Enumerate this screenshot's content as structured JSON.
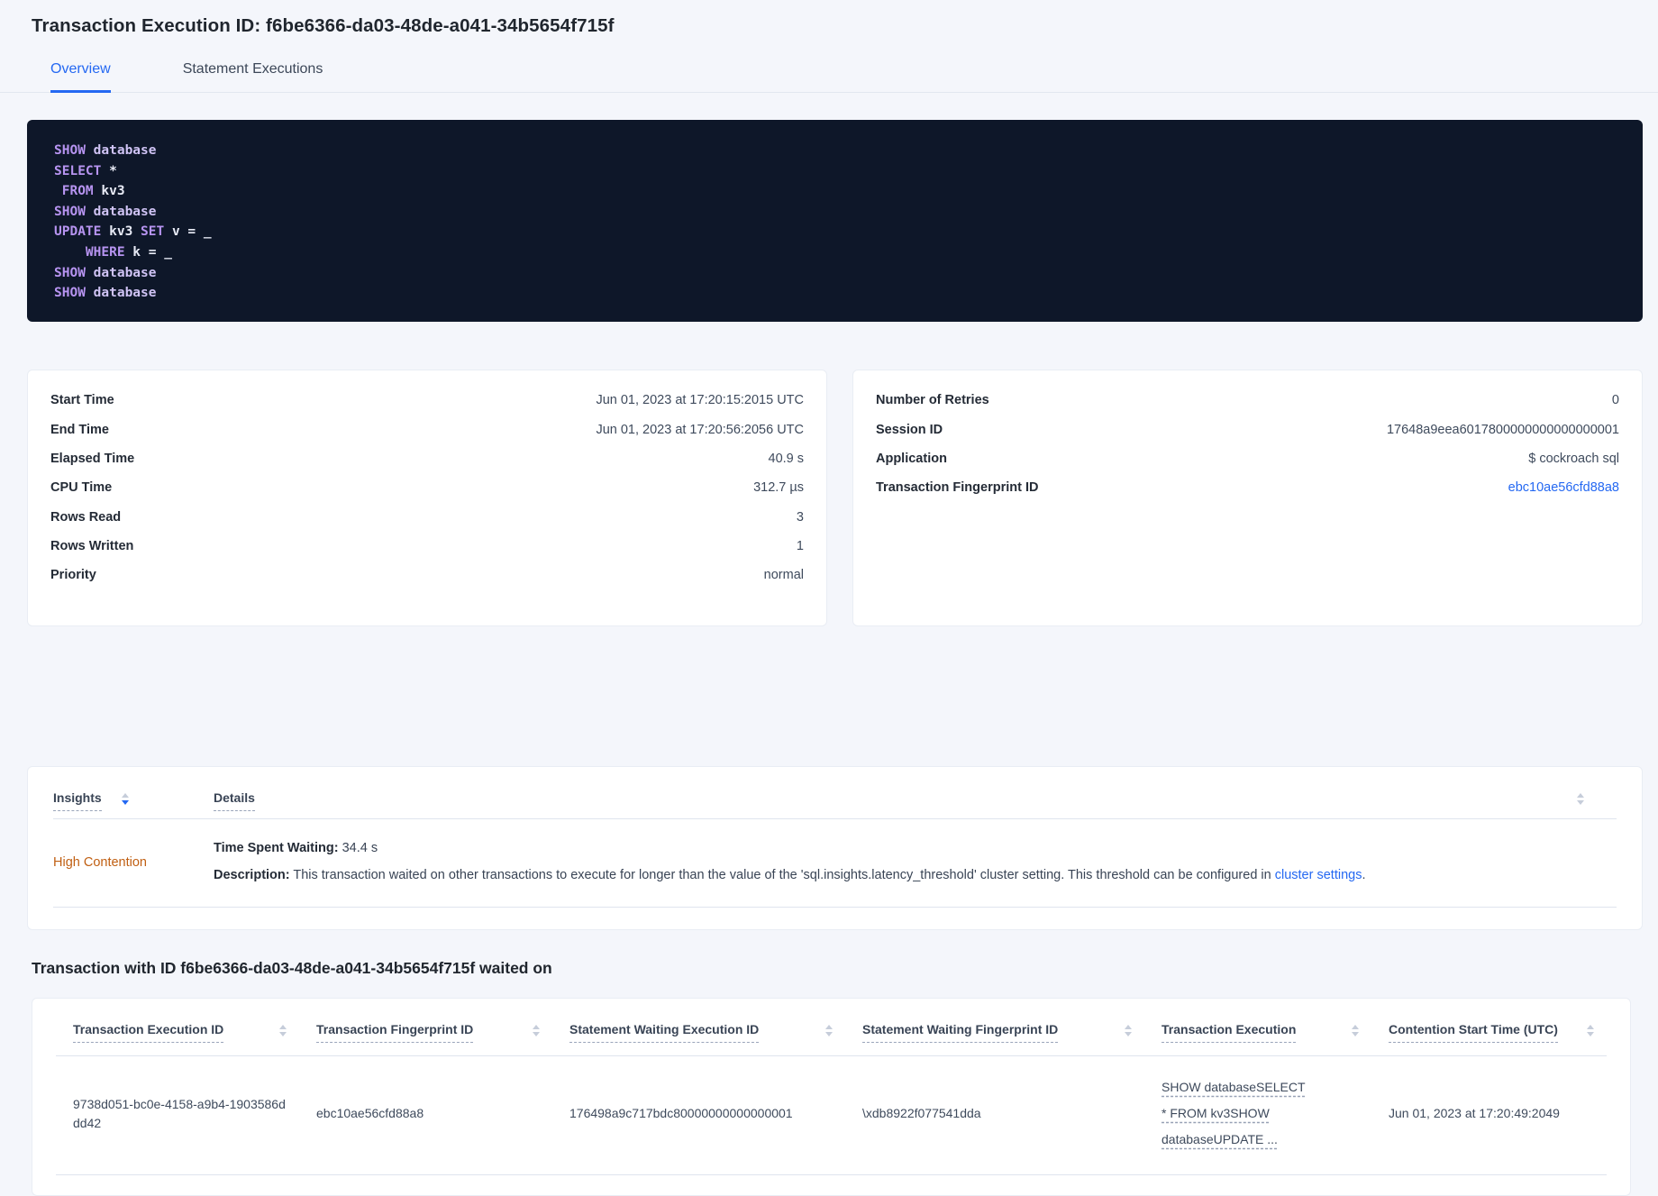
{
  "page": {
    "title": "Transaction Execution ID: f6be6366-da03-48de-a041-34b5654f715f"
  },
  "tabs": [
    {
      "label": "Overview",
      "active": true
    },
    {
      "label": "Statement Executions",
      "active": false
    }
  ],
  "sql": {
    "lines": [
      [
        {
          "t": "kw",
          "s": "SHOW"
        },
        {
          "t": "id",
          "s": " database"
        }
      ],
      [
        {
          "t": "kw",
          "s": "SELECT"
        },
        {
          "t": "pl",
          "s": " *"
        }
      ],
      [
        {
          "t": "kw",
          "s": " FROM"
        },
        {
          "t": "pl",
          "s": " kv3"
        }
      ],
      [
        {
          "t": "kw",
          "s": "SHOW"
        },
        {
          "t": "id",
          "s": " database"
        }
      ],
      [
        {
          "t": "kw",
          "s": "UPDATE"
        },
        {
          "t": "pl",
          "s": " kv3"
        },
        {
          "t": "kw",
          "s": " SET"
        },
        {
          "t": "pl",
          "s": " v = _"
        }
      ],
      [
        {
          "t": "kw",
          "s": "    WHERE"
        },
        {
          "t": "pl",
          "s": " k = _"
        }
      ],
      [
        {
          "t": "kw",
          "s": "SHOW"
        },
        {
          "t": "id",
          "s": " database"
        }
      ],
      [
        {
          "t": "kw",
          "s": "SHOW"
        },
        {
          "t": "id",
          "s": " database"
        }
      ]
    ]
  },
  "left_panel": {
    "rows": [
      {
        "label": "Start Time",
        "value": "Jun 01, 2023 at 17:20:15:2015 UTC"
      },
      {
        "label": "End Time",
        "value": "Jun 01, 2023 at 17:20:56:2056 UTC"
      },
      {
        "label": "Elapsed Time",
        "value": "40.9 s"
      },
      {
        "label": "CPU Time",
        "value": "312.7 µs"
      },
      {
        "label": "Rows Read",
        "value": "3"
      },
      {
        "label": "Rows Written",
        "value": "1"
      },
      {
        "label": "Priority",
        "value": "normal"
      }
    ]
  },
  "right_panel": {
    "rows": [
      {
        "label": "Number of Retries",
        "value": "0"
      },
      {
        "label": "Session ID",
        "value": "17648a9eea6017800000000000000001"
      },
      {
        "label": "Application",
        "value": "$ cockroach sql"
      }
    ],
    "fingerprint_label": "Transaction Fingerprint ID",
    "fingerprint_value": "ebc10ae56cfd88a8"
  },
  "insights_table": {
    "col_insights": "Insights",
    "col_details": "Details",
    "row": {
      "insight": "High Contention",
      "waiting_label": "Time Spent Waiting:",
      "waiting_value": " 34.4 s",
      "desc_label": "Description:",
      "desc_text": " This transaction waited on other transactions to execute for longer than the value of the 'sql.insights.latency_threshold' cluster setting. This threshold can be configured in ",
      "desc_link": "cluster settings",
      "desc_suffix": "."
    }
  },
  "waited_section": {
    "title": "Transaction with ID f6be6366-da03-48de-a041-34b5654f715f waited on",
    "columns": [
      "Transaction Execution ID",
      "Transaction Fingerprint ID",
      "Statement Waiting Execution ID",
      "Statement Waiting Fingerprint ID",
      "Transaction Execution",
      "Contention Start Time (UTC)"
    ],
    "row": {
      "transaction_execution_id": "9738d051-bc0e-4158-a9b4-1903586ddd42",
      "transaction_fingerprint_id": "ebc10ae56cfd88a8",
      "statement_waiting_execution_id": "176498a9c717bdc80000000000000001",
      "statement_waiting_fingerprint_id": "\\xdb8922f077541dda",
      "transaction_execution": "SHOW databaseSELECT * FROM kv3SHOW databaseUPDATE ...",
      "contention_start_time": "Jun 01, 2023 at 17:20:49:2049"
    }
  },
  "colors": {
    "accent_blue": "#2468f2",
    "warning_orange": "#c05f12",
    "code_background": "#0e1729",
    "code_keyword": "#b794f1",
    "code_identifier": "#cfc3f4",
    "code_plain": "#e8ebf6",
    "page_background": "#f4f6fb"
  }
}
